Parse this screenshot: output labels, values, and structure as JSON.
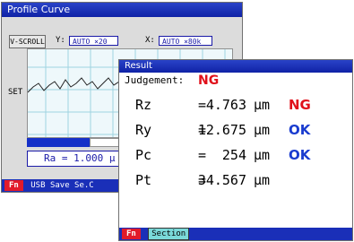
{
  "profile_window": {
    "title": "Profile Curve",
    "vscroll_label": "V-SCROLL",
    "y_label": "Y:",
    "y_value": "AUTO  ×20",
    "x_label": "X:",
    "x_value": "AUTO  ×80k",
    "set_label": "SET",
    "ra_text": "Ra = 1.000 μ",
    "footer": {
      "fn_label": "Fn",
      "text": "USB Save Se.C"
    }
  },
  "result_window": {
    "title": "Result",
    "judgement_label": "Judgement:",
    "judgement_value": "NG",
    "rows": [
      {
        "name": "Rz",
        "eq": "=",
        "value": "4.763",
        "unit": "μm",
        "result": "NG"
      },
      {
        "name": "Ry",
        "eq": "=",
        "value": "12.675",
        "unit": "μm",
        "result": "OK"
      },
      {
        "name": "Pc",
        "eq": "=",
        "value": "254",
        "unit": "μm",
        "result": "OK"
      },
      {
        "name": "Pt",
        "eq": "=",
        "value": "34.567",
        "unit": "μm",
        "result": ""
      }
    ],
    "footer": {
      "fn_label": "Fn",
      "section_label": "Section"
    }
  },
  "colors": {
    "titlebar": "#1a2fb8",
    "ng": "#e0101a",
    "ok": "#1a3ccf",
    "fn_button": "#e21a2a",
    "section_tab": "#7ad9d9"
  }
}
